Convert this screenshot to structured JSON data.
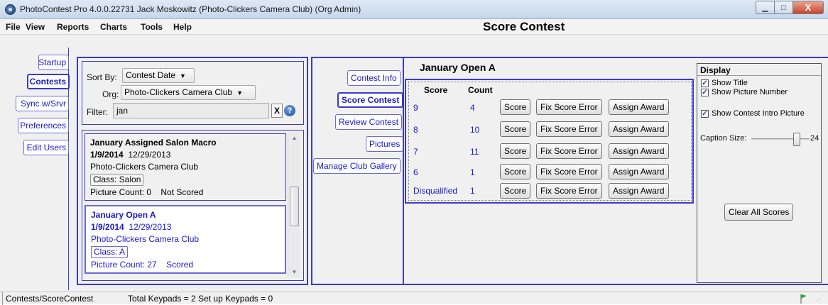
{
  "window": {
    "title": "PhotoContest Pro 4.0.0.22731 Jack Moskowitz (Photo-Clickers Camera Club) (Org Admin)",
    "minimize": "▁",
    "maximize": "□",
    "close": "X"
  },
  "menu": {
    "items": [
      "File",
      "View",
      "Reports",
      "Charts",
      "Tools",
      "Help"
    ],
    "page_title": "Score Contest"
  },
  "nav": {
    "items": [
      "Startup",
      "Contests",
      "Sync w/Srvr",
      "Preferences",
      "Edit Users"
    ],
    "active": "Contests"
  },
  "filters": {
    "sort_label": "Sort By:",
    "sort_value": "Contest Date",
    "org_label": "Org:",
    "org_value": "Photo-Clickers Camera Club",
    "filter_label": "Filter:",
    "filter_value": "jan",
    "clear": "X",
    "help": "?"
  },
  "contests": [
    {
      "name": "January Assigned Salon Macro",
      "date": "1/9/2014",
      "date2": "12/29/2013",
      "club": "Photo-Clickers Camera Club",
      "class": "Class: Salon",
      "pic_count": "Picture Count: 0",
      "status": "Not Scored"
    },
    {
      "name": "January Open A",
      "date": "1/9/2014",
      "date2": "12/29/2013",
      "club": "Photo-Clickers Camera Club",
      "class": "Class: A",
      "pic_count": "Picture Count: 27",
      "status": "Scored"
    }
  ],
  "tabs": {
    "items": [
      "Contest Info",
      "Score Contest",
      "Review Contest",
      "Pictures",
      "Manage Club Gallery"
    ],
    "active": "Score Contest"
  },
  "score": {
    "contest_title": "January Open A",
    "col_score": "Score",
    "col_count": "Count",
    "btn_score": "Score",
    "btn_fix": "Fix Score Error",
    "btn_award": "Assign Award",
    "rows": [
      {
        "score": "9",
        "count": "4"
      },
      {
        "score": "8",
        "count": "10"
      },
      {
        "score": "7",
        "count": "11"
      },
      {
        "score": "6",
        "count": "1"
      },
      {
        "score": "Disqualified",
        "count": "1"
      }
    ]
  },
  "display": {
    "title": "Display",
    "show_title": "Show Title",
    "show_picture_number": "Show Picture Number",
    "show_intro": "Show Contest Intro Picture",
    "caption_label": "Caption Size:",
    "caption_value": "24",
    "caption_fraction": 0.82,
    "clear_all": "Clear All Scores"
  },
  "status": {
    "path": "Contests/ScoreContest",
    "keypads": "Total Keypads = 2  Set up Keypads = 0"
  }
}
